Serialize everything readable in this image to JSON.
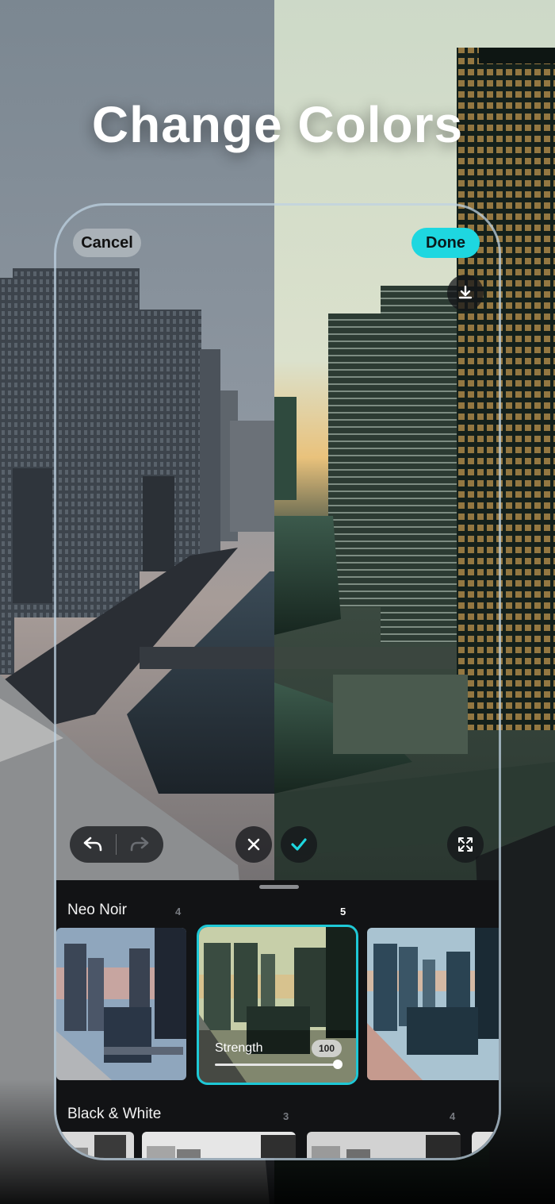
{
  "headline": "Change Colors",
  "editor": {
    "cancel_label": "Cancel",
    "done_label": "Done",
    "download_icon": "download-icon",
    "undo_icon": "undo-icon",
    "redo_icon": "redo-icon",
    "discard_icon": "close-icon",
    "apply_icon": "checkmark-icon",
    "fullscreen_icon": "expand-icon"
  },
  "filters": {
    "categories": [
      {
        "name": "Neo Noir",
        "counts": [
          "4",
          "5"
        ],
        "active_count": "5"
      },
      {
        "name": "Black & White",
        "counts": [
          "3",
          "4"
        ]
      }
    ],
    "selected": {
      "strength_label": "Strength",
      "strength_value": "100",
      "strength": 1.0
    }
  },
  "colors": {
    "accent": "#1ed7e0",
    "panel": "#121315"
  }
}
